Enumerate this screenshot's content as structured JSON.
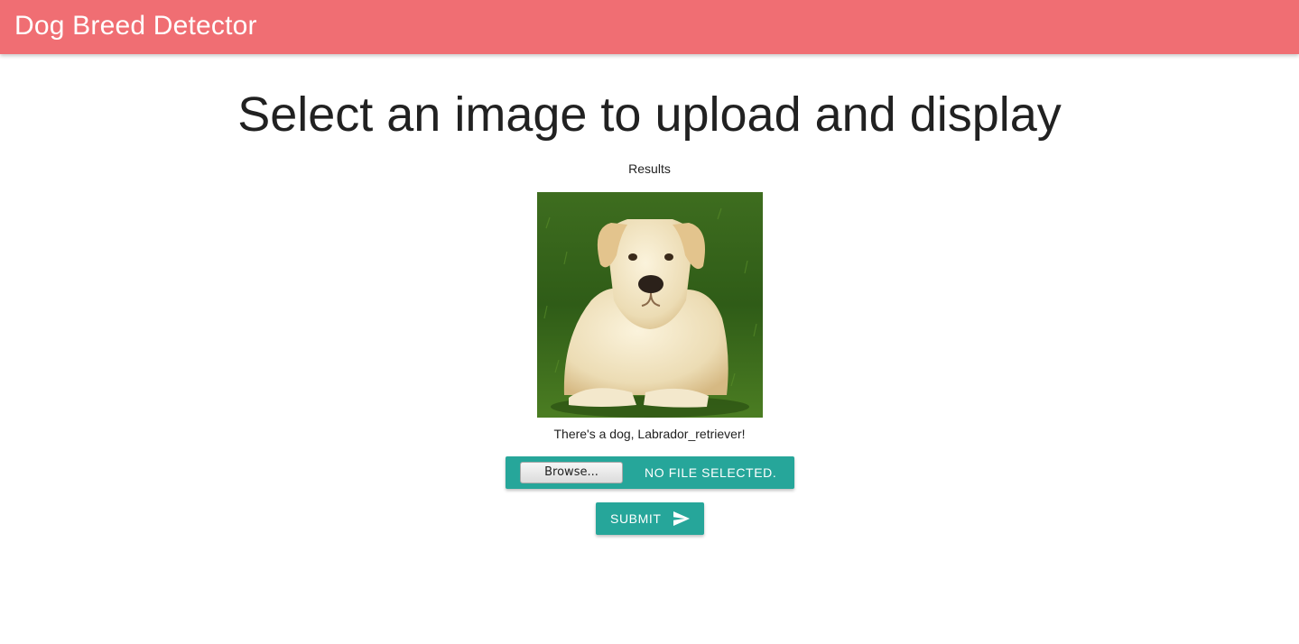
{
  "app": {
    "title": "Dog Breed Detector",
    "accent_color": "#f06e73",
    "button_color": "#26a69a"
  },
  "main": {
    "heading": "Select an image to upload and display",
    "results_label": "Results",
    "image_alt": "Labrador retriever lying on grass",
    "result_text": "There's a dog, Labrador_retriever!"
  },
  "upload": {
    "browse_label": "Browse...",
    "status_text": "NO FILE SELECTED."
  },
  "submit": {
    "label": "SUBMIT",
    "icon": "send-icon"
  }
}
